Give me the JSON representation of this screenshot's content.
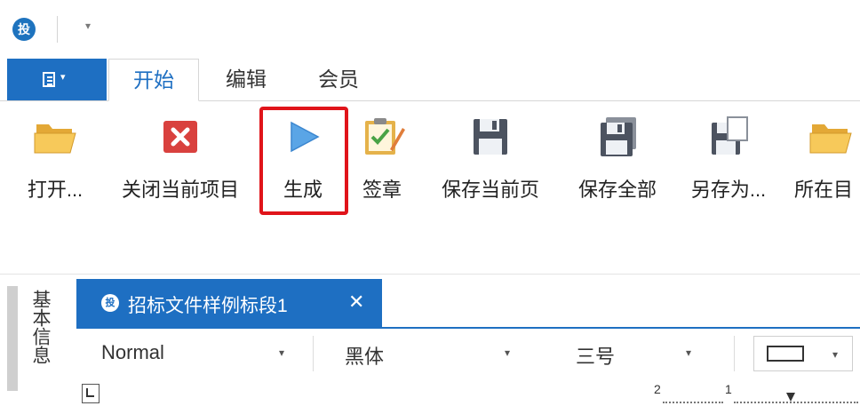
{
  "quick_access": {
    "logo": "投",
    "dropdown": "▾"
  },
  "tabs": {
    "file_arrow": "▾",
    "items": [
      "开始",
      "编辑",
      "会员"
    ]
  },
  "ribbon": {
    "buttons": [
      {
        "label": "打开...",
        "icon": "folder-open-icon"
      },
      {
        "label": "关闭当前项目",
        "icon": "close-project-icon"
      },
      {
        "label": "生成",
        "icon": "play-icon"
      },
      {
        "label": "签章",
        "icon": "clipboard-sign-icon"
      },
      {
        "label": "保存当前页",
        "icon": "save-icon"
      },
      {
        "label": "保存全部",
        "icon": "save-all-icon"
      },
      {
        "label": "另存为...",
        "icon": "save-as-icon"
      },
      {
        "label": "所在目",
        "icon": "folder-icon"
      }
    ],
    "highlight_color": "#e0141a"
  },
  "sidebar": {
    "label": "基本信息"
  },
  "document_tab": {
    "logo": "投",
    "title": "招标文件样例标段1",
    "close": "✕"
  },
  "format_bar": {
    "style": "Normal",
    "font": "黑体",
    "size": "三号",
    "dropdown": "▾"
  },
  "ruler": {
    "labels": [
      "2",
      "1"
    ]
  },
  "colors": {
    "accent": "#1e6fc2",
    "highlight": "#e0141a"
  }
}
